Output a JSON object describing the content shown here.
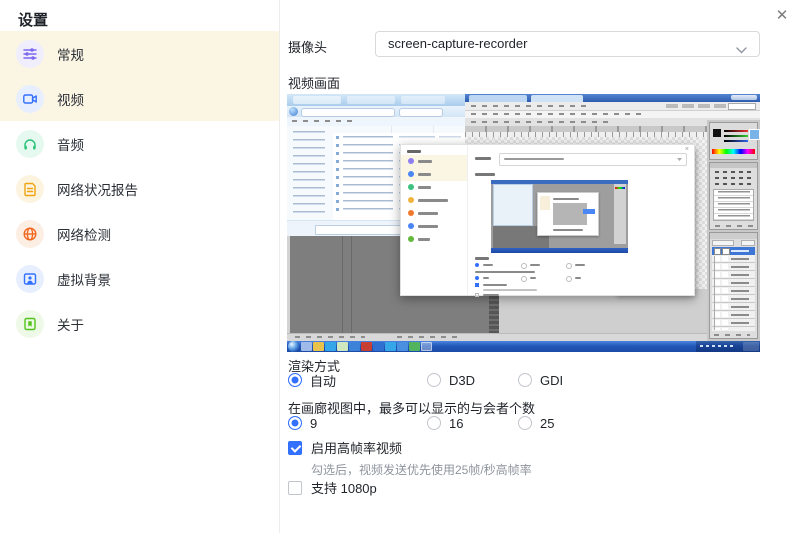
{
  "window": {
    "title": "设置",
    "close_icon": "x-icon"
  },
  "sidebar": {
    "highlight_color": "#fbf5e4",
    "items": [
      {
        "label": "常规",
        "icon": "sliders-icon",
        "icon_color": "#7b68ee",
        "icon_bg": "#f0edfd",
        "highlighted": true,
        "selected": false
      },
      {
        "label": "视频",
        "icon": "video-camera-icon",
        "icon_color": "#3370ff",
        "icon_bg": "#e7efff",
        "highlighted": true,
        "selected": true
      },
      {
        "label": "音频",
        "icon": "headphones-icon",
        "icon_color": "#27c277",
        "icon_bg": "#e6f9f0",
        "highlighted": false,
        "selected": false
      },
      {
        "label": "网络状况报告",
        "icon": "report-document-icon",
        "icon_color": "#f0a412",
        "icon_bg": "#fdf4e0",
        "highlighted": false,
        "selected": false
      },
      {
        "label": "网络检测",
        "icon": "globe-icon",
        "icon_color": "#f2671f",
        "icon_bg": "#fdeee4",
        "highlighted": false,
        "selected": false
      },
      {
        "label": "虚拟背景",
        "icon": "virtual-background-icon",
        "icon_color": "#3370ff",
        "icon_bg": "#e7efff",
        "highlighted": false,
        "selected": false
      },
      {
        "label": "关于",
        "icon": "about-icon",
        "icon_color": "#51c41b",
        "icon_bg": "#eef9e8",
        "highlighted": false,
        "selected": false
      }
    ]
  },
  "camera": {
    "label": "摄像头",
    "value": "screen-capture-recorder",
    "dropdown_icon": "chevron-down-icon"
  },
  "video_preview": {
    "label": "视频画面"
  },
  "render_mode": {
    "label": "渲染方式",
    "options": [
      {
        "label": "自动",
        "selected": true
      },
      {
        "label": "D3D",
        "selected": false
      },
      {
        "label": "GDI",
        "selected": false
      }
    ]
  },
  "gallery_view": {
    "label": "在画廊视图中，最多可以显示的与会者个数",
    "options": [
      {
        "label": "9",
        "selected": true
      },
      {
        "label": "16",
        "selected": false
      },
      {
        "label": "25",
        "selected": false
      }
    ]
  },
  "high_frame_rate": {
    "label": "启用高帧率视频",
    "checked": true,
    "hint": "勾选后，视频发送优先使用25帧/秒高帧率"
  },
  "support_1080p": {
    "label": "支持 1080p",
    "checked": false
  },
  "colors": {
    "accent": "#3370ff",
    "sidebar_highlight": "#fbf5e4",
    "text": "#1f2329",
    "hint_text": "#8f959e"
  }
}
